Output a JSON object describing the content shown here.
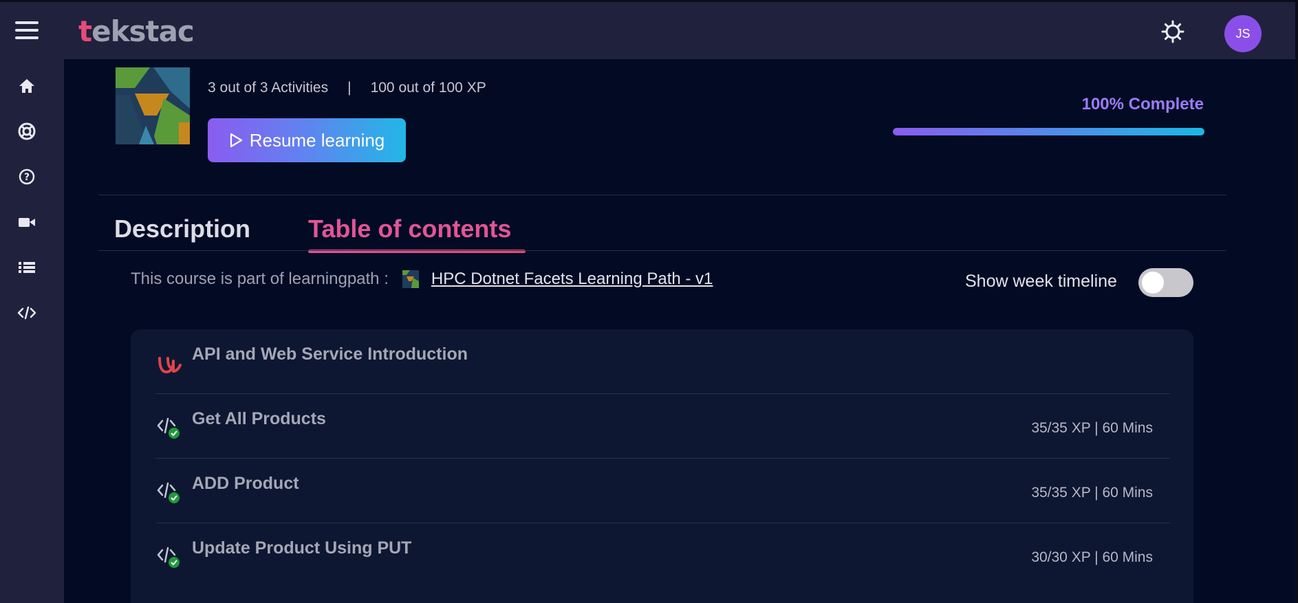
{
  "app": {
    "logo_text": "tekstac",
    "avatar_initials": "JS"
  },
  "sidebar": {
    "items": [
      {
        "icon": "home-icon"
      },
      {
        "icon": "lifebuoy-icon"
      },
      {
        "icon": "help-icon"
      },
      {
        "icon": "video-icon"
      },
      {
        "icon": "list-icon"
      },
      {
        "icon": "code-icon"
      }
    ]
  },
  "course": {
    "activities": "3 out of 3 Activities",
    "separator": "|",
    "xp": "100 out of 100 XP",
    "resume_label": "Resume learning",
    "progress_label": "100% Complete",
    "progress_value": 1.0
  },
  "tabs": [
    {
      "label": "Description",
      "active": false
    },
    {
      "label": "Table of contents",
      "active": true
    }
  ],
  "learning_path": {
    "prefix": "This course is part of learningpath :",
    "link": "HPC Dotnet Facets Learning Path - v1"
  },
  "timeline": {
    "label": "Show week timeline",
    "enabled": false
  },
  "contents": [
    {
      "icon": "udemy-icon",
      "title": "API and Web Service Introduction",
      "meta": ""
    },
    {
      "icon": "code-check-icon",
      "title": "Get All Products",
      "meta": "35/35 XP | 60 Mins"
    },
    {
      "icon": "code-check-icon",
      "title": "ADD Product",
      "meta": "35/35 XP | 60 Mins"
    },
    {
      "icon": "code-check-icon",
      "title": "Update Product Using PUT",
      "meta": "30/30 XP | 60 Mins"
    }
  ],
  "colors": {
    "accent_pink": "#e25597",
    "accent_purple": "#9a7cf7",
    "accent_cyan": "#22b7e6",
    "background": "#030b24"
  }
}
